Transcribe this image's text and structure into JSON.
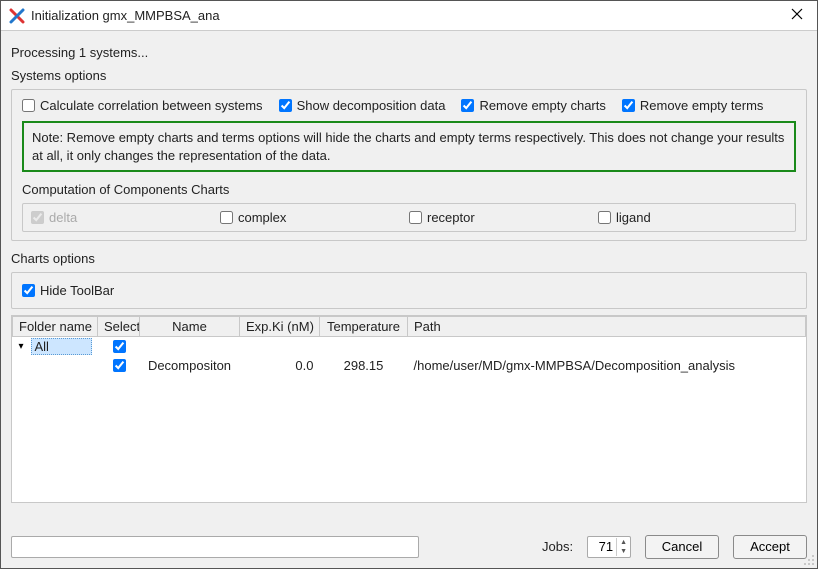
{
  "window": {
    "title": "Initialization gmx_MMPBSA_ana"
  },
  "processing_text": "Processing 1 systems...",
  "systems_options": {
    "label": "Systems options",
    "checks": {
      "correlation": {
        "label": "Calculate correlation between systems",
        "checked": false
      },
      "show_decomp": {
        "label": "Show decomposition data",
        "checked": true
      },
      "remove_empty_charts": {
        "label": "Remove empty charts",
        "checked": true
      },
      "remove_empty_terms": {
        "label": "Remove empty terms",
        "checked": true
      }
    },
    "note": "Note: Remove empty charts and terms options will hide the charts and empty terms respectively. This does not change your results at all, it only changes the representation of the data.",
    "components_label": "Computation of Components Charts",
    "components": {
      "delta": {
        "label": "delta",
        "checked": true,
        "disabled": true
      },
      "complex": {
        "label": "complex",
        "checked": false,
        "disabled": false
      },
      "receptor": {
        "label": "receptor",
        "checked": false,
        "disabled": false
      },
      "ligand": {
        "label": "ligand",
        "checked": false,
        "disabled": false
      }
    }
  },
  "charts_options": {
    "label": "Charts options",
    "hide_toolbar": {
      "label": "Hide ToolBar",
      "checked": true
    }
  },
  "tree": {
    "headers": {
      "folder": "Folder name",
      "select": "Select",
      "name": "Name",
      "expki": "Exp.Ki (nM)",
      "temp": "Temperature",
      "path": "Path"
    },
    "root": {
      "folder": "All",
      "select_checked": true
    },
    "rows": [
      {
        "select_checked": true,
        "name": "Decompositon",
        "expki": "0.0",
        "temp": "298.15",
        "path": "/home/user/MD/gmx-MMPBSA/Decomposition_analysis"
      }
    ]
  },
  "bottom": {
    "jobs_label": "Jobs:",
    "jobs_value": "71",
    "cancel": "Cancel",
    "accept": "Accept"
  }
}
